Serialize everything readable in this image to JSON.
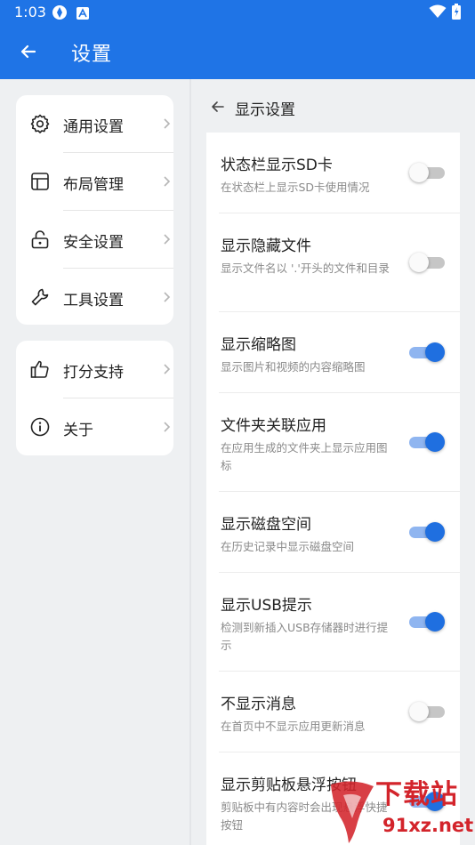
{
  "status_bar": {
    "time": "1:03"
  },
  "app_bar": {
    "title": "设置"
  },
  "sidebar": {
    "groups": [
      {
        "items": [
          {
            "label": "通用设置",
            "icon": "gear-icon"
          },
          {
            "label": "布局管理",
            "icon": "layout-icon"
          },
          {
            "label": "安全设置",
            "icon": "lock-icon"
          },
          {
            "label": "工具设置",
            "icon": "wrench-icon"
          }
        ]
      },
      {
        "items": [
          {
            "label": "打分支持",
            "icon": "thumbs-up-icon"
          },
          {
            "label": "关于",
            "icon": "info-icon"
          }
        ]
      }
    ]
  },
  "detail": {
    "title": "显示设置",
    "settings": [
      {
        "title": "状态栏显示SD卡",
        "desc": "在状态栏上显示SD卡使用情况",
        "enabled": false
      },
      {
        "title": "显示隐藏文件",
        "desc": "显示文件名以 '.'开头的文件和目录",
        "enabled": false
      },
      {
        "title": "显示缩略图",
        "desc": "显示图片和视频的内容缩略图",
        "enabled": true
      },
      {
        "title": "文件夹关联应用",
        "desc": "在应用生成的文件夹上显示应用图标",
        "enabled": true
      },
      {
        "title": "显示磁盘空间",
        "desc": "在历史记录中显示磁盘空间",
        "enabled": true
      },
      {
        "title": "显示USB提示",
        "desc": "检测到新插入USB存储器时进行提示",
        "enabled": true
      },
      {
        "title": "不显示消息",
        "desc": "在首页中不显示应用更新消息",
        "enabled": false
      },
      {
        "title": "显示剪贴板悬浮按钮",
        "desc": "剪贴板中有内容时会出现悬浮快捷按钮",
        "enabled": true
      }
    ]
  },
  "watermark": {
    "text1": "下载站",
    "text2": "91xz.net"
  },
  "colors": {
    "accent": "#1f74e6",
    "toggle_on": "#1f6fe0",
    "toggle_off": "#c6c6c6",
    "watermark": "#d3242b"
  }
}
